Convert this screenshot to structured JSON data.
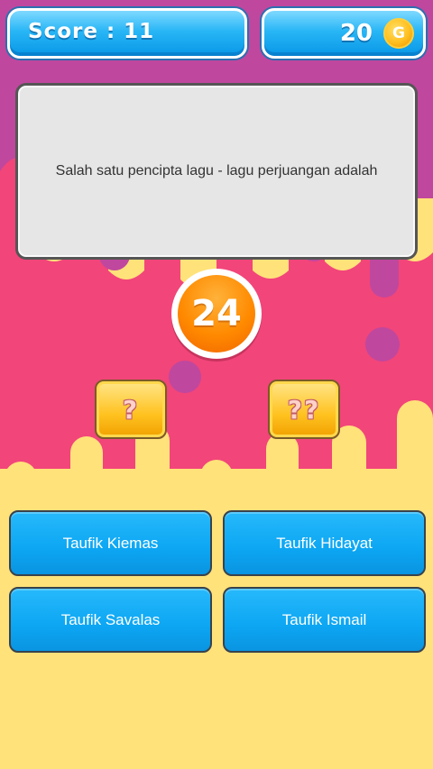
{
  "header": {
    "score_label": "Score : 11",
    "coins": "20",
    "coin_symbol": "G"
  },
  "question": {
    "text": "Salah satu pencipta lagu - lagu perjuangan adalah"
  },
  "timer": {
    "value": "24"
  },
  "hints": [
    {
      "label": "?"
    },
    {
      "label": "??"
    }
  ],
  "answers": [
    {
      "label": "Taufik Kiemas"
    },
    {
      "label": "Taufik Hidayat"
    },
    {
      "label": "Taufik Savalas"
    },
    {
      "label": "Taufik Ismail"
    }
  ],
  "colors": {
    "top_band": "#c0479e",
    "middle_band": "#f2457a",
    "bottom_band": "#ffe27a",
    "answer_button": "#0ca6f3",
    "hint_button": "#ffc21f",
    "timer": "#ff8a00"
  }
}
